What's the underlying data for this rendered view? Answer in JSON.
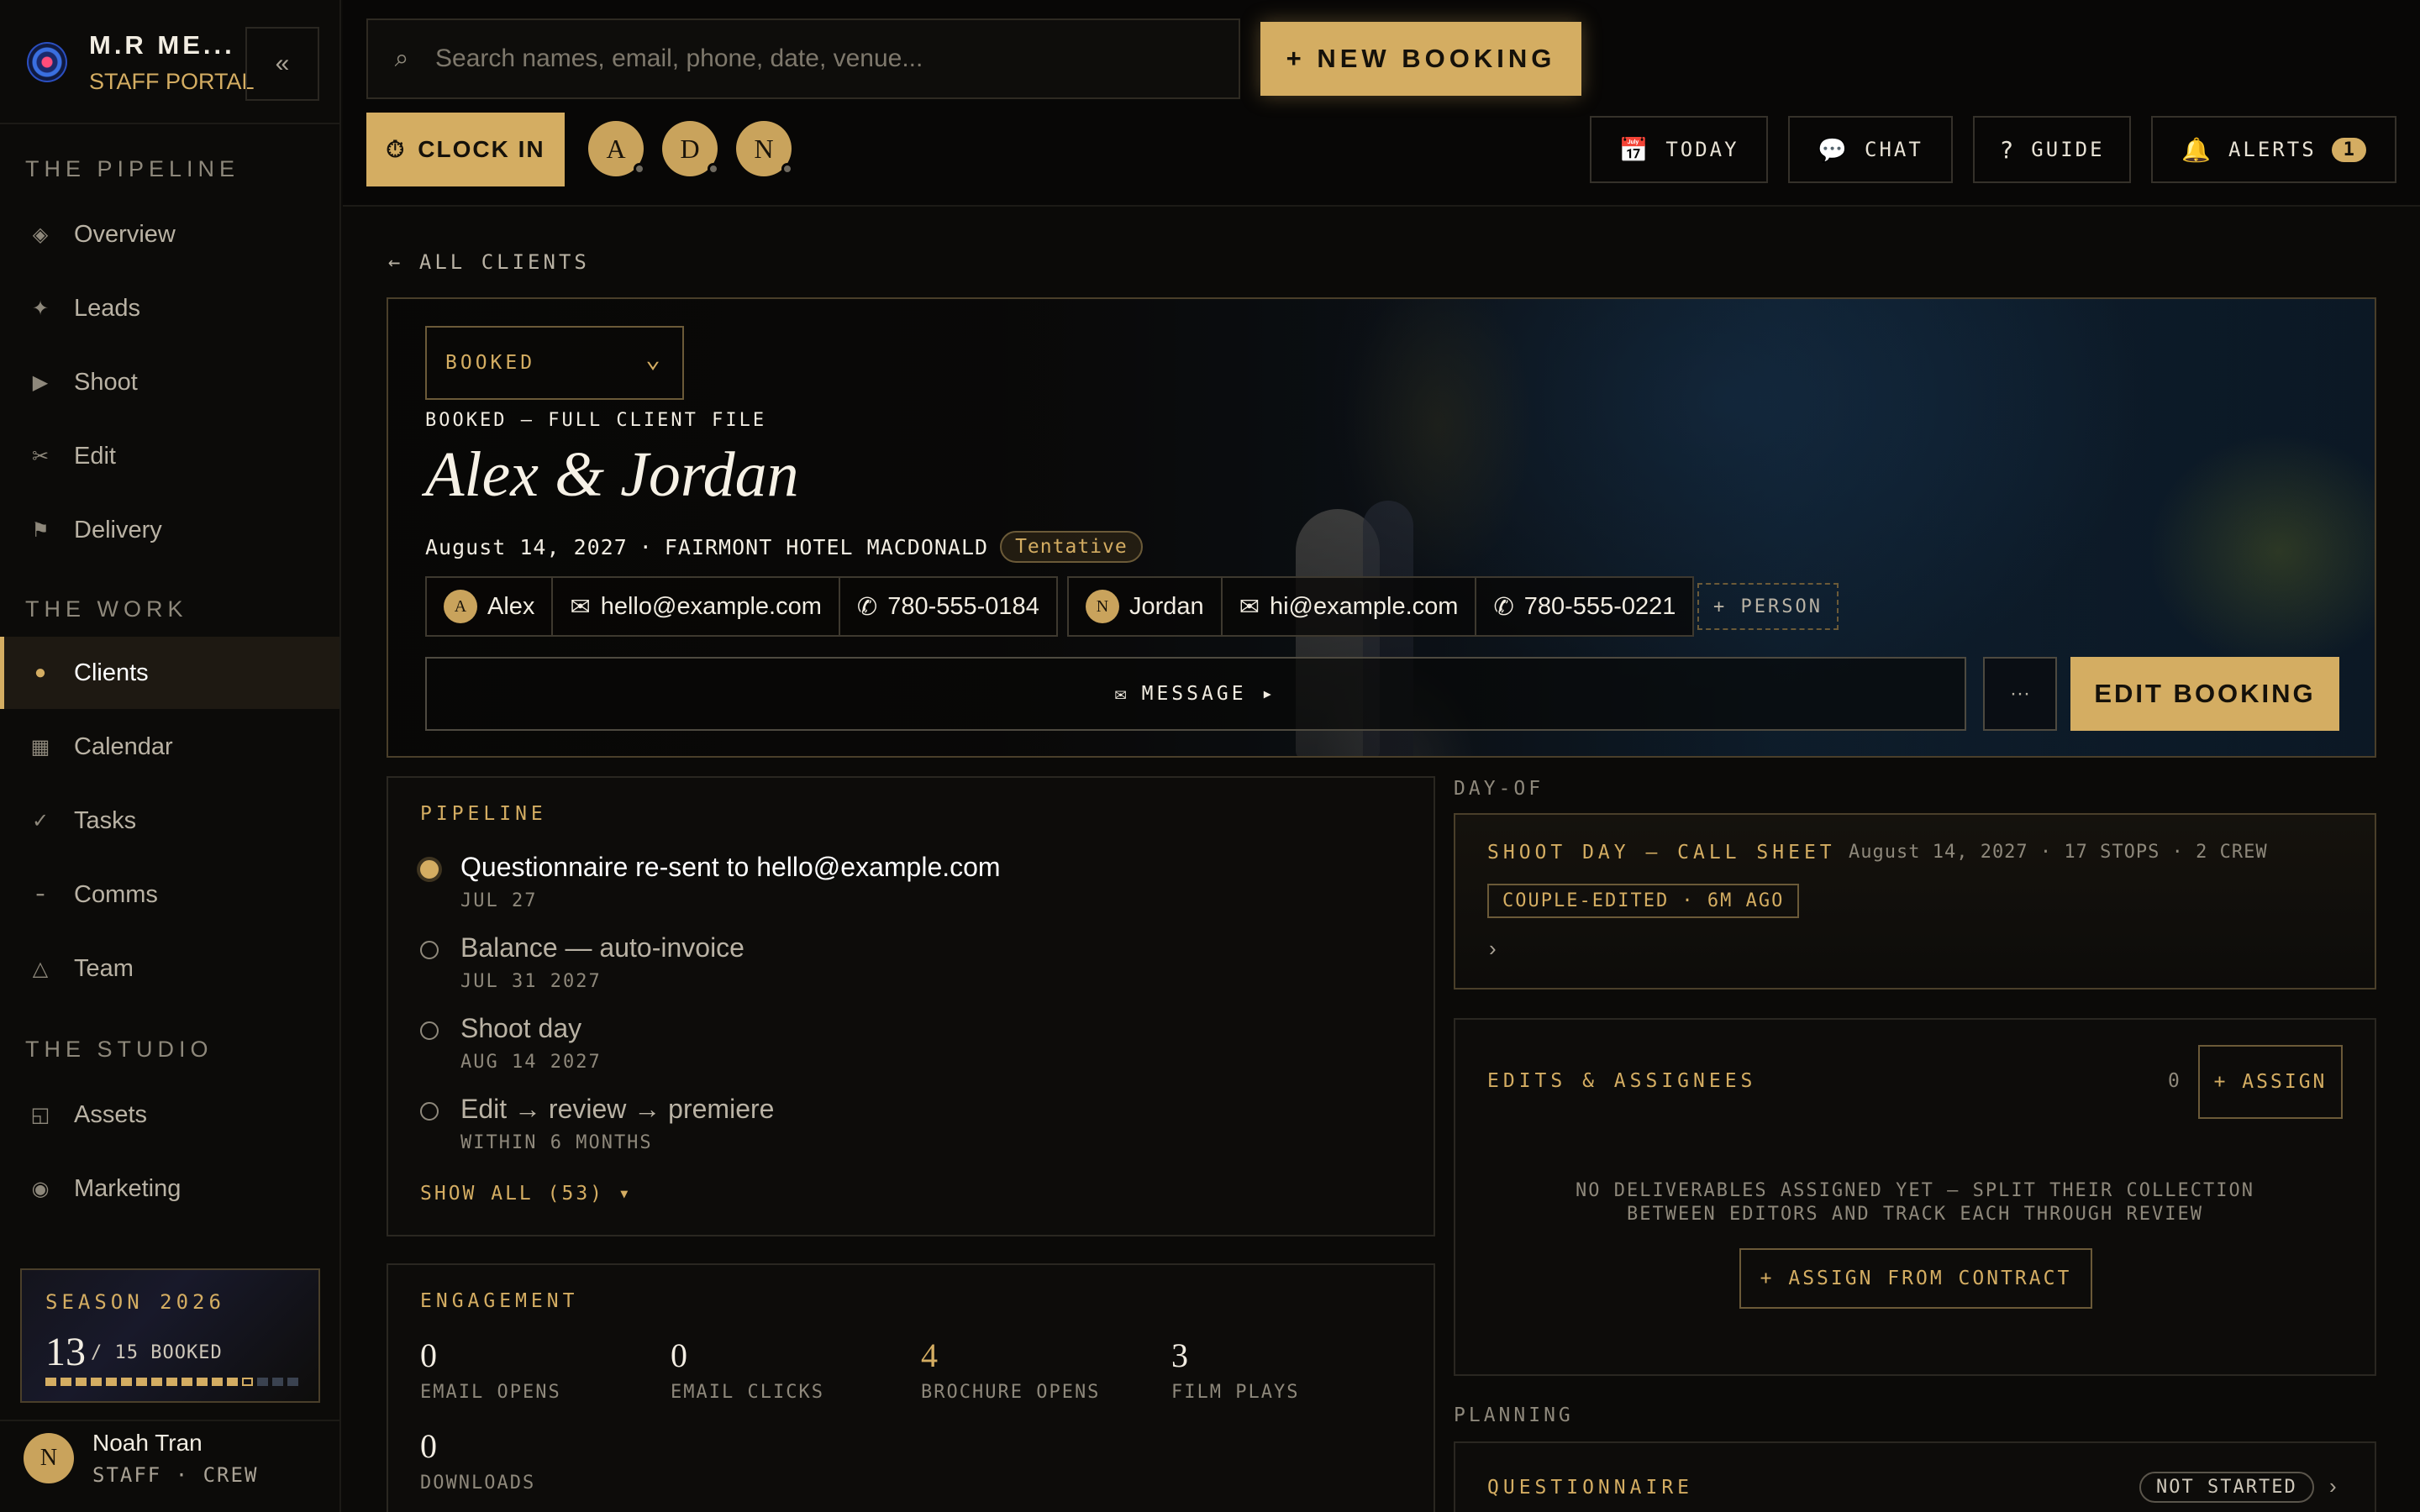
{
  "brand": {
    "name": "M.R ME...",
    "subtitle": "STAFF PORTAL",
    "collapse_glyph": "«"
  },
  "sidebar": {
    "sections": [
      {
        "label": "THE PIPELINE",
        "items": [
          {
            "label": "Overview",
            "icon": "diamond-icon",
            "glyph": "◈"
          },
          {
            "label": "Leads",
            "icon": "sparkle-icon",
            "glyph": "✦"
          },
          {
            "label": "Shoot",
            "icon": "play-icon",
            "glyph": "▶"
          },
          {
            "label": "Edit",
            "icon": "scissors-icon",
            "glyph": "✂"
          },
          {
            "label": "Delivery",
            "icon": "flag-icon",
            "glyph": "⚑"
          }
        ]
      },
      {
        "label": "THE WORK",
        "items": [
          {
            "label": "Clients",
            "icon": "dot-icon",
            "glyph": "●",
            "active": true
          },
          {
            "label": "Calendar",
            "icon": "grid-icon",
            "glyph": "▦"
          },
          {
            "label": "Tasks",
            "icon": "check-icon",
            "glyph": "✓"
          },
          {
            "label": "Comms",
            "icon": "dash-icon",
            "glyph": "━"
          },
          {
            "label": "Team",
            "icon": "triangle-icon",
            "glyph": "△"
          }
        ]
      },
      {
        "label": "THE STUDIO",
        "items": [
          {
            "label": "Assets",
            "icon": "frame-icon",
            "glyph": "◱"
          },
          {
            "label": "Marketing",
            "icon": "target-icon",
            "glyph": "◉"
          }
        ]
      }
    ],
    "season": {
      "title": "SEASON 2026",
      "booked": "13",
      "of_text": "/ 15 BOOKED",
      "booked_count": 13,
      "total": 15
    },
    "user": {
      "initial": "N",
      "name": "Noah Tran",
      "role": "STAFF · CREW"
    }
  },
  "topbar": {
    "search_placeholder": "Search names, email, phone, date, venue...",
    "search_glyph": "⌕",
    "new_booking": "+ NEW BOOKING",
    "clock_in": "CLOCK IN",
    "clock_glyph": "⏱",
    "crew": [
      "A",
      "D",
      "N"
    ],
    "buttons": {
      "today": "TODAY",
      "today_glyph": "📅",
      "chat": "CHAT",
      "chat_glyph": "💬",
      "guide": "GUIDE",
      "guide_glyph": "?",
      "alerts": "ALERTS",
      "alerts_glyph": "🔔",
      "alerts_count": "1"
    }
  },
  "client": {
    "back": "← ALL CLIENTS",
    "status": "BOOKED",
    "status_chevron": "⌄",
    "file_label": "BOOKED — FULL CLIENT FILE",
    "name": "Alex & Jordan",
    "date": "August 14, 2027",
    "separator": "·",
    "venue": "FAIRMONT HOTEL MACDONALD",
    "tentative": "Tentative",
    "people": [
      {
        "initial": "A",
        "name": "Alex",
        "email": "hello@example.com",
        "phone": "780-555-0184"
      },
      {
        "initial": "N",
        "name": "Jordan",
        "email": "hi@example.com",
        "phone": "780-555-0221"
      }
    ],
    "mail_glyph": "✉",
    "phone_glyph": "✆",
    "add_person": "+ PERSON",
    "message": "MESSAGE ▸",
    "more": "···",
    "edit_booking": "EDIT BOOKING"
  },
  "pipeline": {
    "title": "PIPELINE",
    "steps": [
      {
        "text": "Questionnaire re-sent to hello@example.com",
        "date": "JUL 27",
        "done": true
      },
      {
        "text": "Balance — auto-invoice",
        "date": "JUL 31 2027",
        "done": false
      },
      {
        "text": "Shoot day",
        "date": "AUG 14 2027",
        "done": false
      },
      {
        "text": "Edit → review → premiere",
        "date": "WITHIN 6 MONTHS",
        "done": false
      }
    ],
    "show_all": "SHOW ALL (53) ▾"
  },
  "engagement": {
    "title": "ENGAGEMENT",
    "stats": [
      {
        "value": "0",
        "label": "EMAIL OPENS"
      },
      {
        "value": "0",
        "label": "EMAIL CLICKS"
      },
      {
        "value": "4",
        "label": "BROCHURE OPENS",
        "highlight": true
      },
      {
        "value": "3",
        "label": "FILM PLAYS"
      },
      {
        "value": "0",
        "label": "DOWNLOADS"
      }
    ]
  },
  "day_of": {
    "label": "DAY-OF",
    "title": "SHOOT DAY — CALL SHEET",
    "meta": "August 14, 2027 · 17 STOPS · 2 CREW",
    "tag": "COUPLE-EDITED · 6M AGO",
    "chevron": "›"
  },
  "edits": {
    "title": "EDITS & ASSIGNEES",
    "count": "0",
    "assign": "+ ASSIGN",
    "empty_line1": "NO DELIVERABLES ASSIGNED YET — SPLIT THEIR COLLECTION",
    "empty_line2": "BETWEEN EDITORS AND TRACK EACH THROUGH REVIEW",
    "assign_from_contract": "+ ASSIGN FROM CONTRACT"
  },
  "planning": {
    "label": "PLANNING",
    "questionnaire": "QUESTIONNAIRE",
    "status": "NOT STARTED",
    "chevron": "›"
  },
  "colors": {
    "accent": "#d4ad62",
    "background": "#0b0a08",
    "panel": "#0d0c0a",
    "border": "#2a2721"
  }
}
